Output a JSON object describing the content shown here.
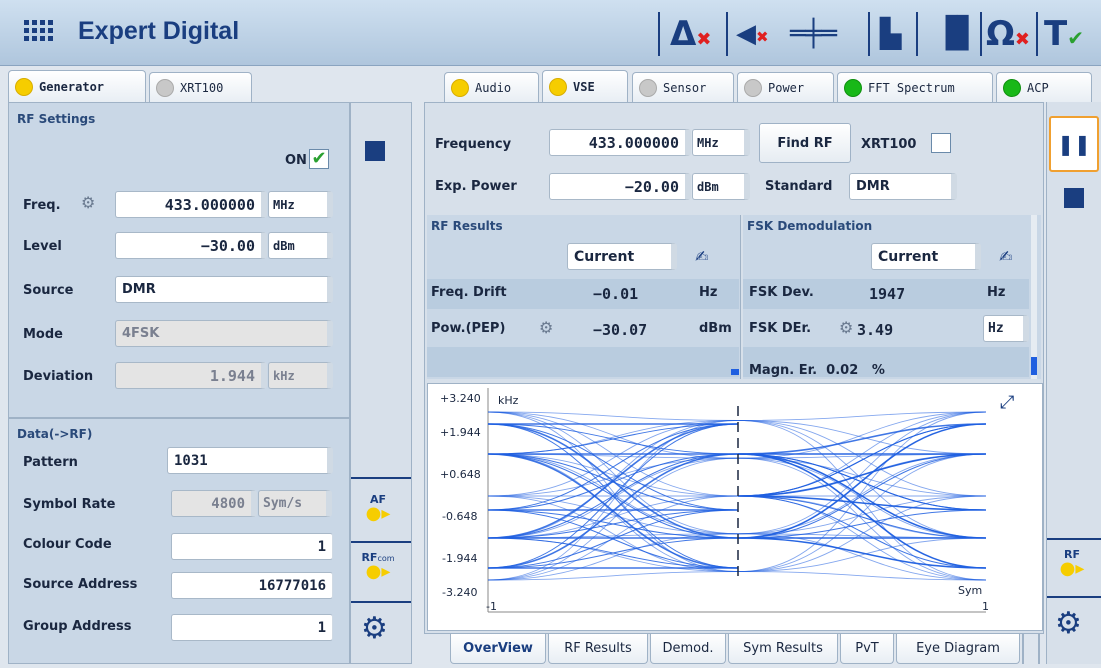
{
  "app": {
    "title": "Expert Digital"
  },
  "toolbar": {
    "icons": [
      "delta-x-icon",
      "mute-icon",
      "plug-icon",
      "file-icon",
      "split-icon",
      "ohm-icon",
      "tt-icon"
    ]
  },
  "left_tabs": [
    {
      "label": "Generator",
      "status": "yellow"
    },
    {
      "label": "XRT100",
      "status": "gray"
    }
  ],
  "right_tabs": [
    {
      "label": "Audio",
      "status": "yellow"
    },
    {
      "label": "VSE",
      "status": "yellow"
    },
    {
      "label": "Sensor",
      "status": "gray"
    },
    {
      "label": "Power",
      "status": "gray"
    },
    {
      "label": "FFT Spectrum",
      "status": "green"
    },
    {
      "label": "ACP",
      "status": "green"
    }
  ],
  "rf_settings": {
    "title": "RF Settings",
    "on_label": "ON",
    "freq_label": "Freq.",
    "freq_value": "433.000000",
    "freq_unit": "MHz",
    "level_label": "Level",
    "level_value": "−30.00",
    "level_unit": "dBm",
    "source_label": "Source",
    "source_value": "DMR",
    "mode_label": "Mode",
    "mode_value": "4FSK",
    "deviation_label": "Deviation",
    "deviation_value": "1.944",
    "deviation_unit": "kHz"
  },
  "data_rf": {
    "title": "Data(->RF)",
    "pattern_label": "Pattern",
    "pattern_value": "1031",
    "symrate_label": "Symbol Rate",
    "symrate_value": "4800",
    "symrate_unit": "Sym/s",
    "colour_label": "Colour Code",
    "colour_value": "1",
    "srcaddr_label": "Source Address",
    "srcaddr_value": "16777016",
    "grpaddr_label": "Group Address",
    "grpaddr_value": "1"
  },
  "side": {
    "af_label": "AF",
    "rf_label": "RF",
    "rf_sub": "com"
  },
  "vse": {
    "freq_label": "Frequency",
    "freq_value": "433.000000",
    "freq_unit": "MHz",
    "find_rf": "Find RF",
    "xrt_label": "XRT100",
    "exp_power_label": "Exp. Power",
    "exp_power_value": "−20.00",
    "exp_power_unit": "dBm",
    "standard_label": "Standard",
    "standard_value": "DMR"
  },
  "rf_results": {
    "title": "RF Results",
    "mode": "Current",
    "rows": [
      {
        "label": "Freq. Drift",
        "value": "−0.01",
        "unit": "Hz"
      },
      {
        "label": "Pow.(PEP)",
        "value": "−30.07",
        "unit": "dBm"
      }
    ]
  },
  "fsk": {
    "title": "FSK Demodulation",
    "mode": "Current",
    "rows": [
      {
        "label": "FSK Dev.",
        "value": "1947",
        "unit": "Hz"
      },
      {
        "label": "FSK DEr.",
        "value": "3.49",
        "unit": "Hz"
      }
    ],
    "partial": "Magn. Er.  0.02   %"
  },
  "eye": {
    "unit_y": "kHz",
    "unit_x": "Sym",
    "yticks": [
      "+3.240",
      "+1.944",
      "+0.648",
      "-0.648",
      "-1.944",
      "-3.240"
    ],
    "xticks": [
      "-1",
      "1"
    ]
  },
  "bottom_tabs": [
    "OverView",
    "RF Results",
    "Demod.",
    "Sym Results",
    "PvT",
    "Eye Diagram"
  ],
  "colors": {
    "accent": "#1a3e80",
    "trace": "#1f5fe0",
    "panel": "#c9d7e6",
    "on_check": "#2aa030"
  }
}
